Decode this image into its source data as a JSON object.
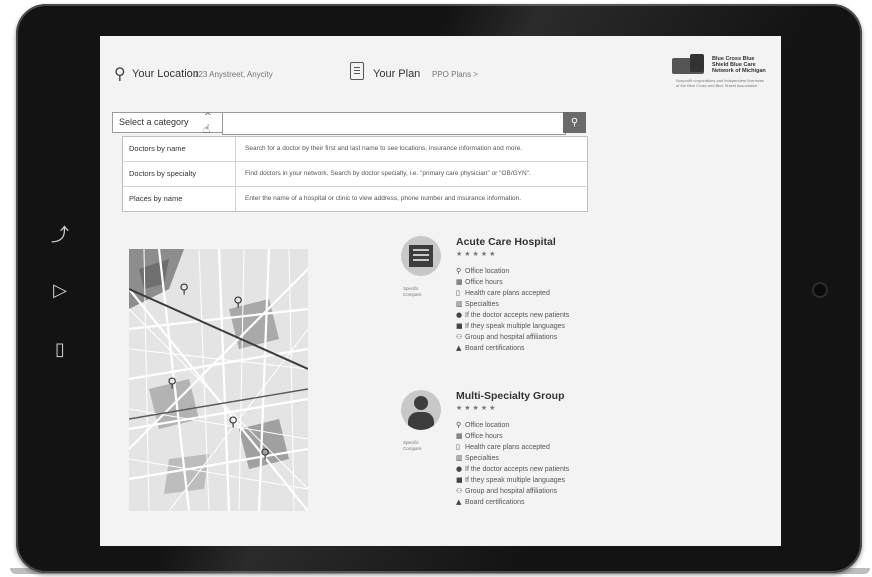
{
  "header": {
    "location_label": "Your Location",
    "location_value": "123 Anystreet, Anycity",
    "plan_label": "Your Plan",
    "plan_value": "PPO Plans >"
  },
  "logo": {
    "name": "Blue Cross Blue Shield Blue Care Network of Michigan",
    "tagline": "Nonprofit corporations and independent licensees of the Blue Cross and Blue Shield Association"
  },
  "search": {
    "category_label": "Select a category",
    "placeholder": "",
    "button_icon": "search-icon"
  },
  "categories": [
    {
      "name": "Doctors by name",
      "description": "Search for a doctor by their first and last name to see locations, insurance information and more."
    },
    {
      "name": "Doctors by specialty",
      "description": "Find doctors in your network. Search by doctor specialty, i.e. \"primary care physician\" or \"OB/GYN\"."
    },
    {
      "name": "Places by name",
      "description": "Enter the name of a hospital or clinic to view address, phone number and insurance information."
    }
  ],
  "results": [
    {
      "title": "Acute Care Hospital",
      "stars": "★★★★★",
      "specific_compare": "Specific\nCompare",
      "attributes": [
        "Office location",
        "Office hours",
        "Health care plans accepted",
        "Specialties",
        "If the doctor accepts new patients",
        "If they speak multiple languages",
        "Group and hospital affiliations",
        "Board certifications"
      ]
    },
    {
      "title": "Multi-Specialty Group",
      "stars": "★★★★★",
      "specific_compare": "Specific\nCompare",
      "attributes": [
        "Office location",
        "Office hours",
        "Health care plans accepted",
        "Specialties",
        "If the doctor accepts new patients",
        "If they speak multiple languages",
        "Group and hospital affiliations",
        "Board certifications"
      ]
    }
  ],
  "icons": {
    "location": "location-pin-icon",
    "plan": "clipboard-icon",
    "map_pin": "map-pin-icon"
  },
  "colors": {
    "screen_bg": "#f3f3f3",
    "frame": "#131313",
    "search_button": "#6a6a6a"
  }
}
